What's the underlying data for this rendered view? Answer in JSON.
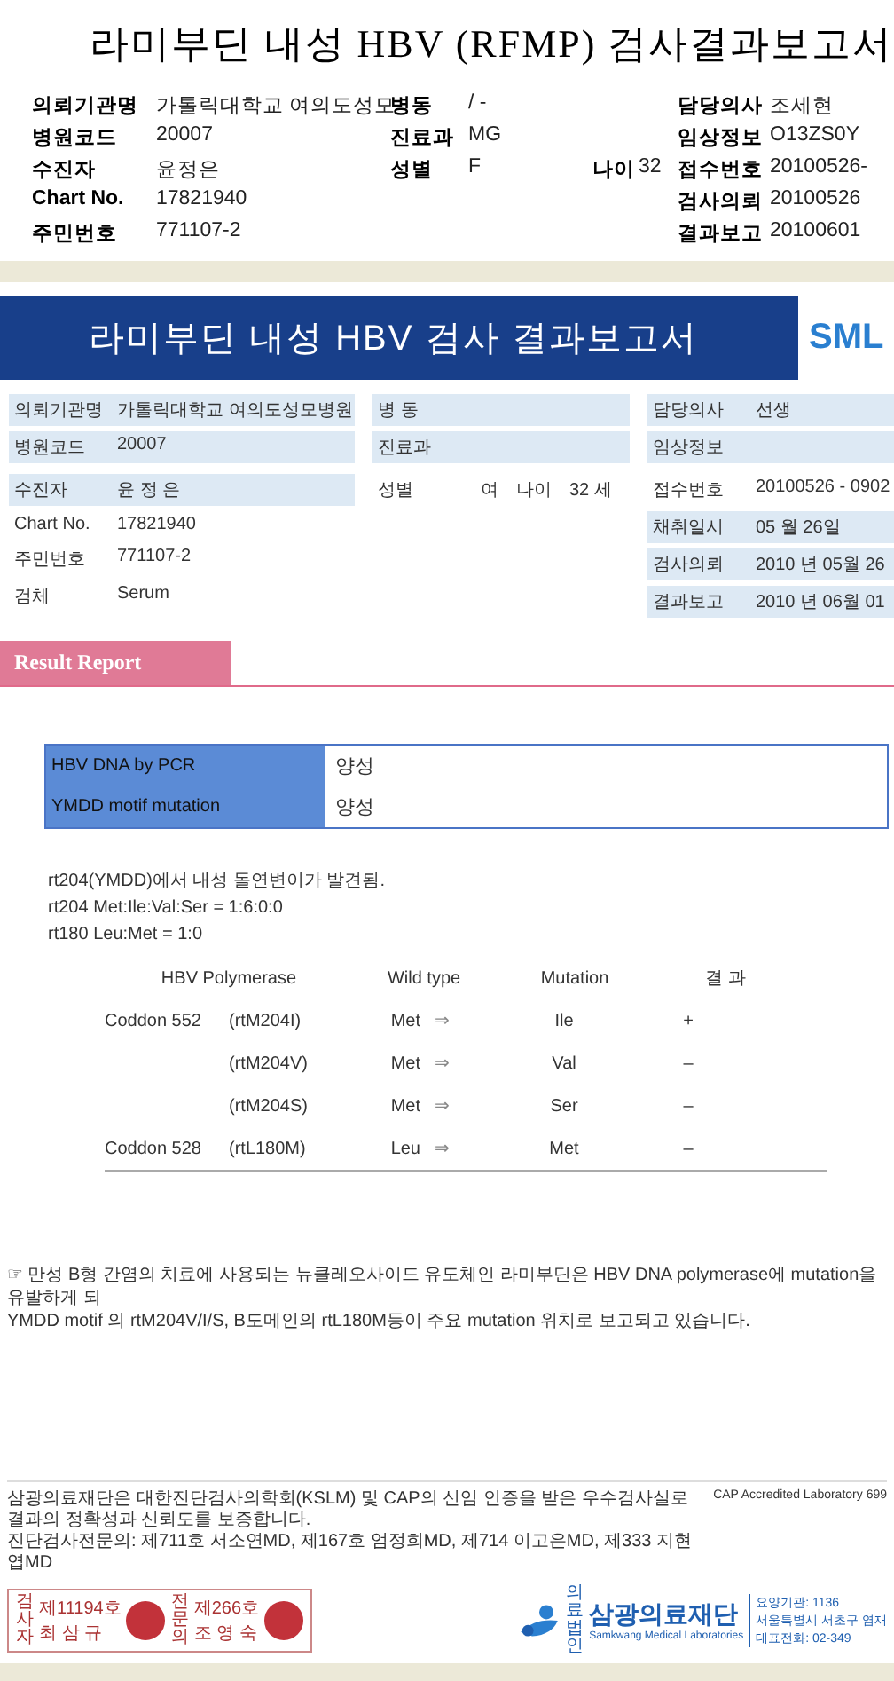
{
  "header": {
    "title": "라미부딘 내성 HBV (RFMP) 검사결과보고서",
    "rows": [
      {
        "left": {
          "label": "의뢰기관명",
          "value": "가톨릭대학교 여의도성모"
        },
        "middle": {
          "label": "병동",
          "value": "/ -"
        },
        "right": {
          "label": "담당의사",
          "value": "조세현"
        }
      },
      {
        "left": {
          "label": "병원코드",
          "value": "20007"
        },
        "middle": {
          "label": "진료과",
          "value": "MG"
        },
        "right": {
          "label": "임상정보",
          "value": "O13ZS0Y"
        }
      },
      {
        "left": {
          "label": "수진자",
          "value": "윤정은"
        },
        "middle": {
          "label": "성별",
          "value": "F"
        },
        "age": {
          "label": "나이",
          "value": "32"
        },
        "right": {
          "label": "접수번호",
          "value": "20100526-"
        }
      },
      {
        "left": {
          "label": "Chart No.",
          "value": "17821940"
        },
        "right": {
          "label": "검사의뢰",
          "value": "20100526"
        }
      },
      {
        "left": {
          "label": "주민번호",
          "value": "771107-2"
        },
        "right": {
          "label": "결과보고",
          "value": "20100601"
        }
      }
    ]
  },
  "report": {
    "title": "라미부딘 내성 HBV 검사 결과보고서",
    "logo": "SML",
    "info_columns": [
      [
        {
          "label": "의뢰기관명",
          "value": "가톨릭대학교 여의도성모병원",
          "shaded": true
        },
        {
          "label": "병원코드",
          "value": "20007",
          "shaded": true
        },
        {
          "label": "수진자",
          "value": "윤 정 은",
          "shaded": true
        },
        {
          "label": "Chart No.",
          "value": "17821940",
          "shaded": false
        },
        {
          "label": "주민번호",
          "value": "771107-2",
          "shaded": false
        },
        {
          "label": "검체",
          "value": "Serum",
          "shaded": false
        }
      ],
      [
        {
          "label": "병 동",
          "shaded": true
        },
        {
          "label": "진료과",
          "shaded": true
        },
        {
          "label": "성별",
          "value": "여",
          "extra_label": "나이",
          "extra_value": "32 세",
          "shaded": false
        }
      ],
      [
        {
          "label": "담당의사",
          "value": "선생",
          "shaded": true
        },
        {
          "label": "임상정보",
          "shaded": true
        },
        {
          "label": "접수번호",
          "value": "20100526 - 0902",
          "shaded": false
        },
        {
          "label": "채취일시",
          "value": "05 월  26일",
          "shaded": true
        },
        {
          "label": "검사의뢰",
          "value": "2010 년  05월  26",
          "shaded": true
        },
        {
          "label": "결과보고",
          "value": "2010 년  06월  01",
          "shaded": true
        }
      ]
    ],
    "section_title": "Result Report",
    "results": [
      {
        "test": "HBV DNA by PCR",
        "result": "양성"
      },
      {
        "test": "YMDD motif mutation",
        "result": "양성"
      }
    ],
    "notes": [
      "rt204(YMDD)에서 내성 돌연변이가 발견됨.",
      "rt204 Met:Ile:Val:Ser = 1:6:0:0",
      "rt180 Leu:Met = 1:0"
    ],
    "table": {
      "columns": [
        "HBV Polymerase",
        "Wild type",
        "Mutation",
        "결 과"
      ],
      "rows": [
        {
          "codon": "Coddon 552",
          "variant": "(rtM204I)",
          "wild": "Met",
          "arrow": "⇒",
          "mutation": "Ile",
          "result": "+"
        },
        {
          "variant": "(rtM204V)",
          "wild": "Met",
          "arrow": "⇒",
          "mutation": "Val",
          "result": "–"
        },
        {
          "variant": "(rtM204S)",
          "wild": "Met",
          "arrow": "⇒",
          "mutation": "Ser",
          "result": "–"
        },
        {
          "codon": "Coddon 528",
          "variant": "(rtL180M)",
          "wild": "Leu",
          "arrow": "⇒",
          "mutation": "Met",
          "result": "–"
        }
      ]
    },
    "comment": [
      "☞ 만성 B형 간염의 치료에 사용되는 뉴클레오사이드 유도체인 라미부딘은 HBV DNA polymerase에 mutation을 유발하게 되",
      "YMDD motif 의 rtM204V/I/S, B도메인의 rtL180M등이 주요 mutation 위치로 보고되고 있습니다."
    ],
    "footer": {
      "lines": [
        "삼광의료재단은 대한진단검사의학회(KSLM) 및 CAP의 신임 인증을 받은 우수검사실로 결과의 정확성과 신뢰도를 보증합니다.",
        "진단검사전문의: 제711호 서소연MD, 제167호 엄정희MD, 제714 이고은MD, 제333 지현엽MD"
      ],
      "accreditation": "CAP Accredited Laboratory 699",
      "stamps": [
        {
          "role": "검사자",
          "number": "제11194호",
          "name": "최 삼 규"
        },
        {
          "role": "전문의",
          "number": "제266호",
          "name": "조 영 숙"
        }
      ],
      "org_prefix": "의료법인",
      "org_name": "삼광의료재단",
      "org_english": "Samkwang Medical Laboratories",
      "contact": [
        "요양기관: 1136",
        "서울특별시 서초구 염재",
        "대표전화: 02-349"
      ]
    }
  }
}
